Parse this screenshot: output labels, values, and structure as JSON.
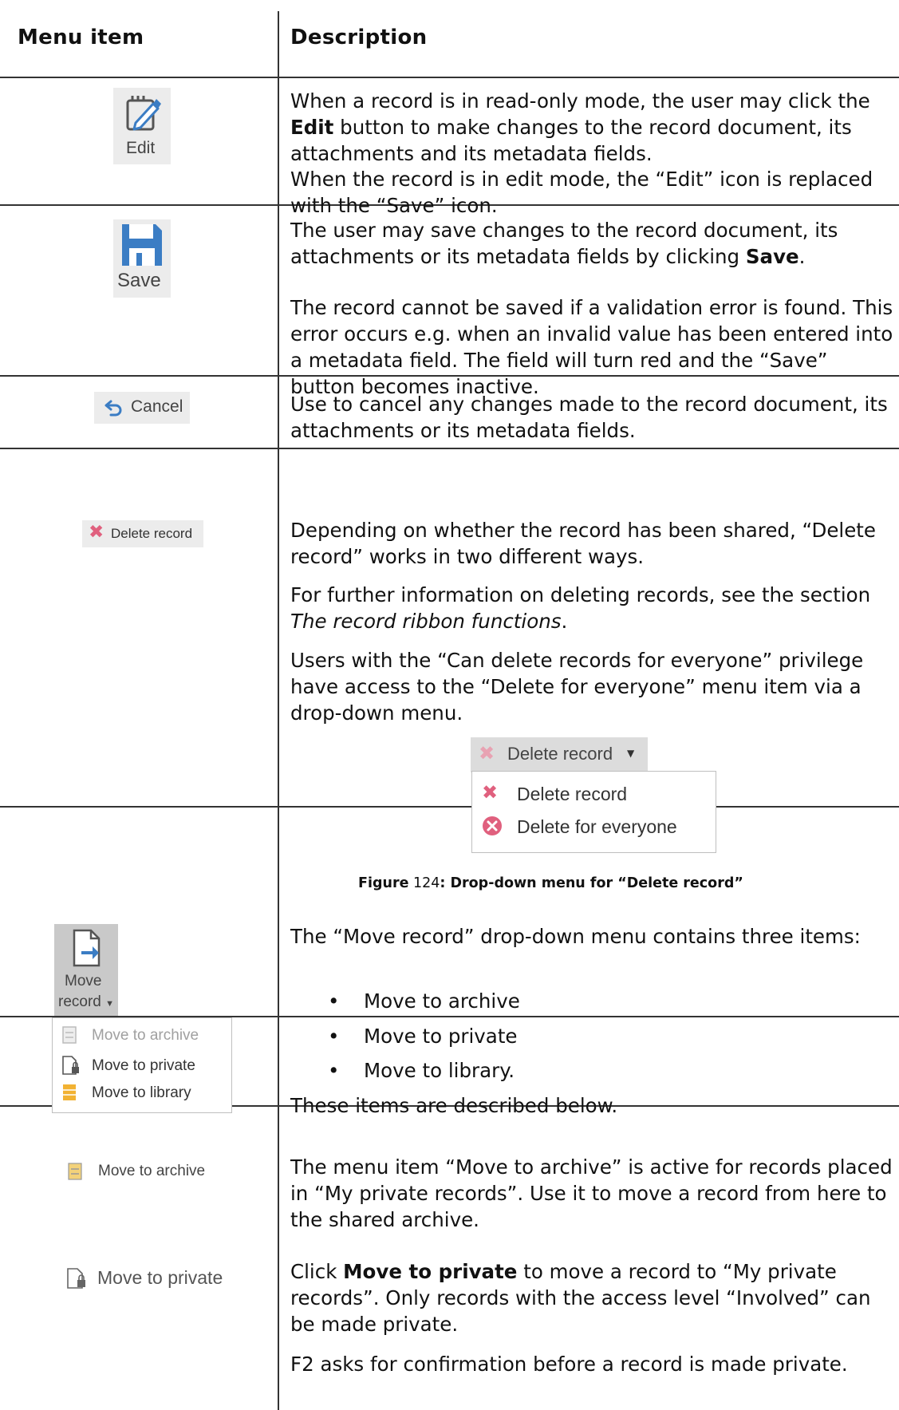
{
  "header": {
    "col1": "Menu item",
    "col2": "Description"
  },
  "rows": {
    "edit": {
      "icon_label": "Edit",
      "p1_a": "When a record is in read-only mode, the user may click the ",
      "p1_b": "Edit",
      "p1_c": " button to make changes to the record document, its attachments and its metadata fields.",
      "p2": "When the record is in edit mode, the “Edit” icon is replaced with the “Save” icon."
    },
    "save": {
      "icon_label": "Save",
      "p1_a": "The user may save changes to the record document, its attachments or its metadata fields by clicking ",
      "p1_b": "Save",
      "p1_c": ".",
      "p2": "The record cannot be saved if a validation error is found. This error occurs e.g. when an invalid value has been entered into a metadata field. The field will turn red and the “Save” button becomes inactive."
    },
    "cancel": {
      "icon_label": "Cancel",
      "p1": "Use to cancel any changes made to the record document, its attachments or its metadata fields."
    },
    "delete": {
      "icon_label": "Delete record",
      "p1": "Depending on whether the record has been shared, “Delete record” works in two different ways.",
      "p2_a": "For further information on deleting records, see the section ",
      "p2_b": "The record ribbon functions",
      "p2_c": ".",
      "p3": "Users with the “Can delete records for everyone” privilege have access to the “Delete for everyone” menu item via a drop-down menu.",
      "menu_button": "Delete record",
      "menu_items": [
        "Delete record",
        "Delete for everyone"
      ],
      "caption_a": "Figure",
      "caption_b": " 124",
      "caption_c": ": Drop-down menu for “Delete record”"
    },
    "move": {
      "icon_label_1": "Move",
      "icon_label_2": "record",
      "menu_items": [
        "Move to archive",
        "Move to private",
        "Move to library"
      ],
      "p1": "The “Move record” drop-down menu contains three items:",
      "bullets": [
        "Move to archive",
        "Move to private",
        "Move to library."
      ],
      "p2": "These items are described below."
    },
    "archive": {
      "icon_label": "Move to archive",
      "p1": "The menu item “Move to archive” is active for records placed in “My private records”. Use it to move a record from here to the shared archive."
    },
    "private": {
      "icon_label": "Move to private",
      "p1_a": "Click ",
      "p1_b": "Move to private",
      "p1_c": " to move a record to “My private records”. Only records with the access level “Involved” can be made private.",
      "p2": "F2 asks for confirmation before a record is made private."
    }
  },
  "colors": {
    "rule": "#333333",
    "icon_blue": "#3b7dc4",
    "delete_red": "#e0607e",
    "tile_bg": "#ececec",
    "disabled_text": "#a0a0a0",
    "folder_orange": "#f2b233"
  }
}
